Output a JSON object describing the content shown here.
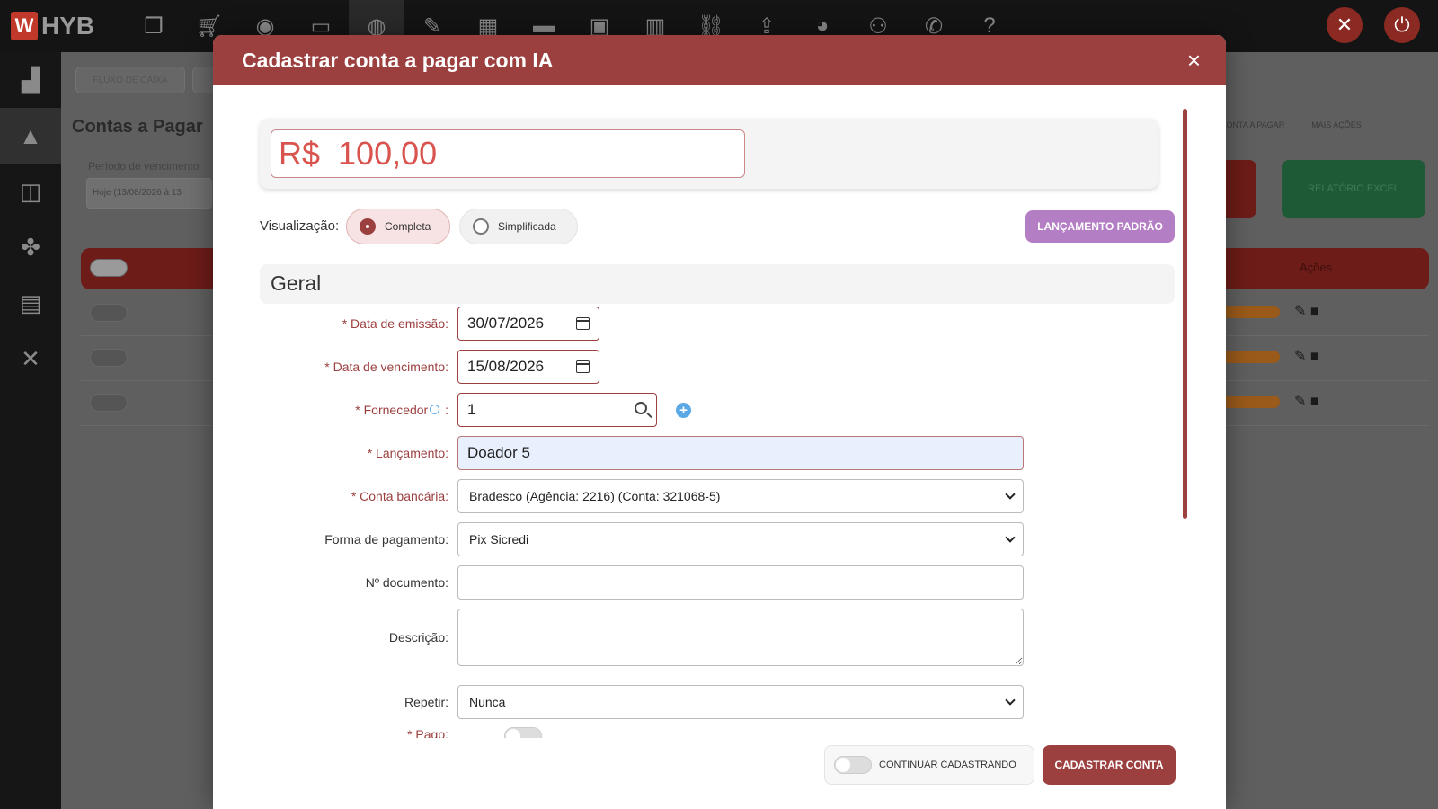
{
  "app": {
    "logo_text": "HYB",
    "bg_tab": "FLUXO DE CAIXA",
    "bg_page_title": "Contas a Pagar",
    "bg_period_label": "Período de vencimento",
    "bg_period_value": "Hoje (13/08/2026 à 13",
    "bg_link_1": "CONTA A PAGAR",
    "bg_link_2": "MAIS AÇÕES",
    "bg_excel": "RELATÓRIO EXCEL",
    "bg_acoes": "Ações"
  },
  "modal": {
    "title": "Cadastrar conta a pagar com IA",
    "close_label": "×",
    "amount_value": "R$  100,00",
    "visualizacao_label": "Visualização:",
    "option_completa": "Completa",
    "option_simplificada": "Simplificada",
    "lancamento_padrao_label": "LANÇAMENTO PADRÃO",
    "section_title": "Geral",
    "fields": {
      "data_emissao_label": "Data de emissão:",
      "data_emissao_value": "30/07/2026",
      "data_vencimento_label": "Data de vencimento:",
      "data_vencimento_value": "15/08/2026",
      "fornecedor_label": "Fornecedor",
      "fornecedor_colon": ":",
      "fornecedor_value": "1",
      "lancamento_label": "Lançamento:",
      "lancamento_value": "Doador 5",
      "conta_bancaria_label": "Conta bancária:",
      "conta_bancaria_value": "Bradesco (Agência: 2216) (Conta: 321068-5)",
      "forma_pagamento_label": "Forma de pagamento:",
      "forma_pagamento_value": "Pix Sicredi",
      "documento_label": "Nº documento:",
      "documento_value": "",
      "descricao_label": "Descrição:",
      "descricao_value": "",
      "repetir_label": "Repetir:",
      "repetir_value": "Nunca",
      "pago_label": "Pago:"
    },
    "required_mark": "*",
    "continuar_label": "CONTINUAR CADASTRANDO",
    "submit_label": "CADASTRAR CONTA"
  }
}
